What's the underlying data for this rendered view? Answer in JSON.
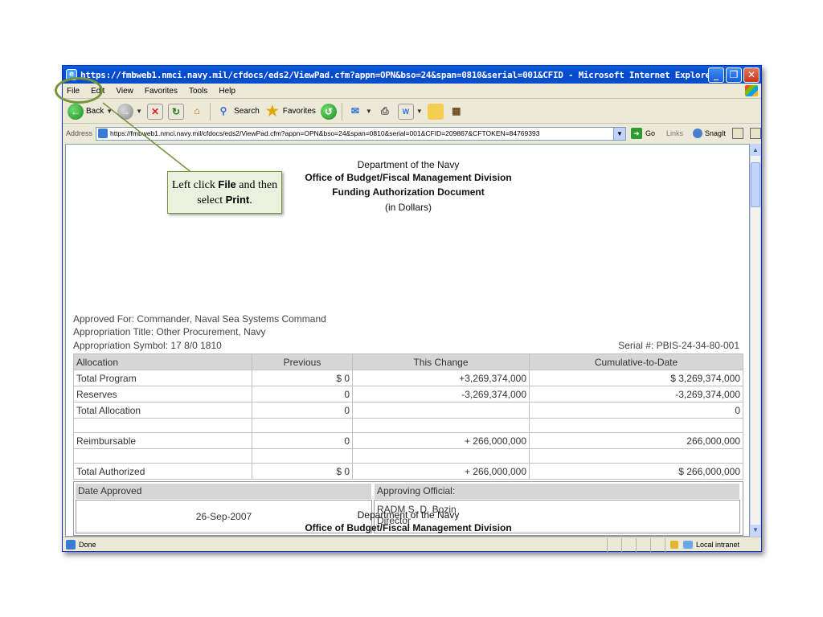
{
  "titlebar": {
    "title": "https://fmbweb1.nmci.navy.mil/cfdocs/eds2/ViewPad.cfm?appn=OPN&bso=24&span=0810&serial=001&CFID - Microsoft Internet Explorer p",
    "minimize_glyph": "_",
    "maximize_glyph": "❐",
    "close_glyph": "✕"
  },
  "menu": [
    "File",
    "Edit",
    "View",
    "Favorites",
    "Tools",
    "Help"
  ],
  "toolbar": {
    "back": "Back",
    "search": "Search",
    "favorites": "Favorites"
  },
  "addressbar": {
    "label": "Address",
    "url": "https://fmbweb1.nmci.navy.mil/cfdocs/eds2/ViewPad.cfm?appn=OPN&bso=24&span=0810&serial=001&CFID=209867&CFTOKEN=84769393",
    "go": "Go",
    "links": "Links",
    "snagit": "SnagIt"
  },
  "document": {
    "heading1": "Department of the Navy",
    "heading2": "Office of Budget/Fiscal Management Division",
    "heading3": "Funding Authorization Document",
    "heading4": "(in Dollars)",
    "approved_for": "Approved For: Commander, Naval Sea Systems Command",
    "appropriation_title": "Appropriation Title: Other Procurement, Navy",
    "appropriation_symbol": "Appropriation Symbol: 17 8/0 1810",
    "serial": "Serial #: PBIS-24-34-80-001",
    "table": {
      "headers": [
        "Allocation",
        "Previous",
        "This Change",
        "Cumulative-to-Date"
      ],
      "rows": [
        [
          "Total Program",
          "$ 0",
          "+3,269,374,000",
          "$ 3,269,374,000"
        ],
        [
          "Reserves",
          "0",
          "-3,269,374,000",
          "-3,269,374,000"
        ],
        [
          "Total Allocation",
          "0",
          "",
          "0"
        ],
        [
          "",
          "",
          "",
          ""
        ],
        [
          "Reimbursable",
          "0",
          "+ 266,000,000",
          "266,000,000"
        ],
        [
          "",
          "",
          "",
          ""
        ],
        [
          "Total Authorized",
          "$ 0",
          "+ 266,000,000",
          "$ 266,000,000"
        ]
      ]
    },
    "approval": {
      "date_header": "Date Approved",
      "official_header": "Approving Official:",
      "date": "26-Sep-2007",
      "official_name": "RADM S. D. Bozin",
      "official_title": "Director"
    },
    "repeat_heading1": "Department of the Navy",
    "repeat_heading2": "Office of Budget/Fiscal Management Division"
  },
  "statusbar": {
    "status": "Done",
    "zone": "Local intranet"
  },
  "callout": {
    "text_a": "Left click ",
    "text_b": "File",
    "text_c": " and then select ",
    "text_d": "Print",
    "text_e": "."
  }
}
